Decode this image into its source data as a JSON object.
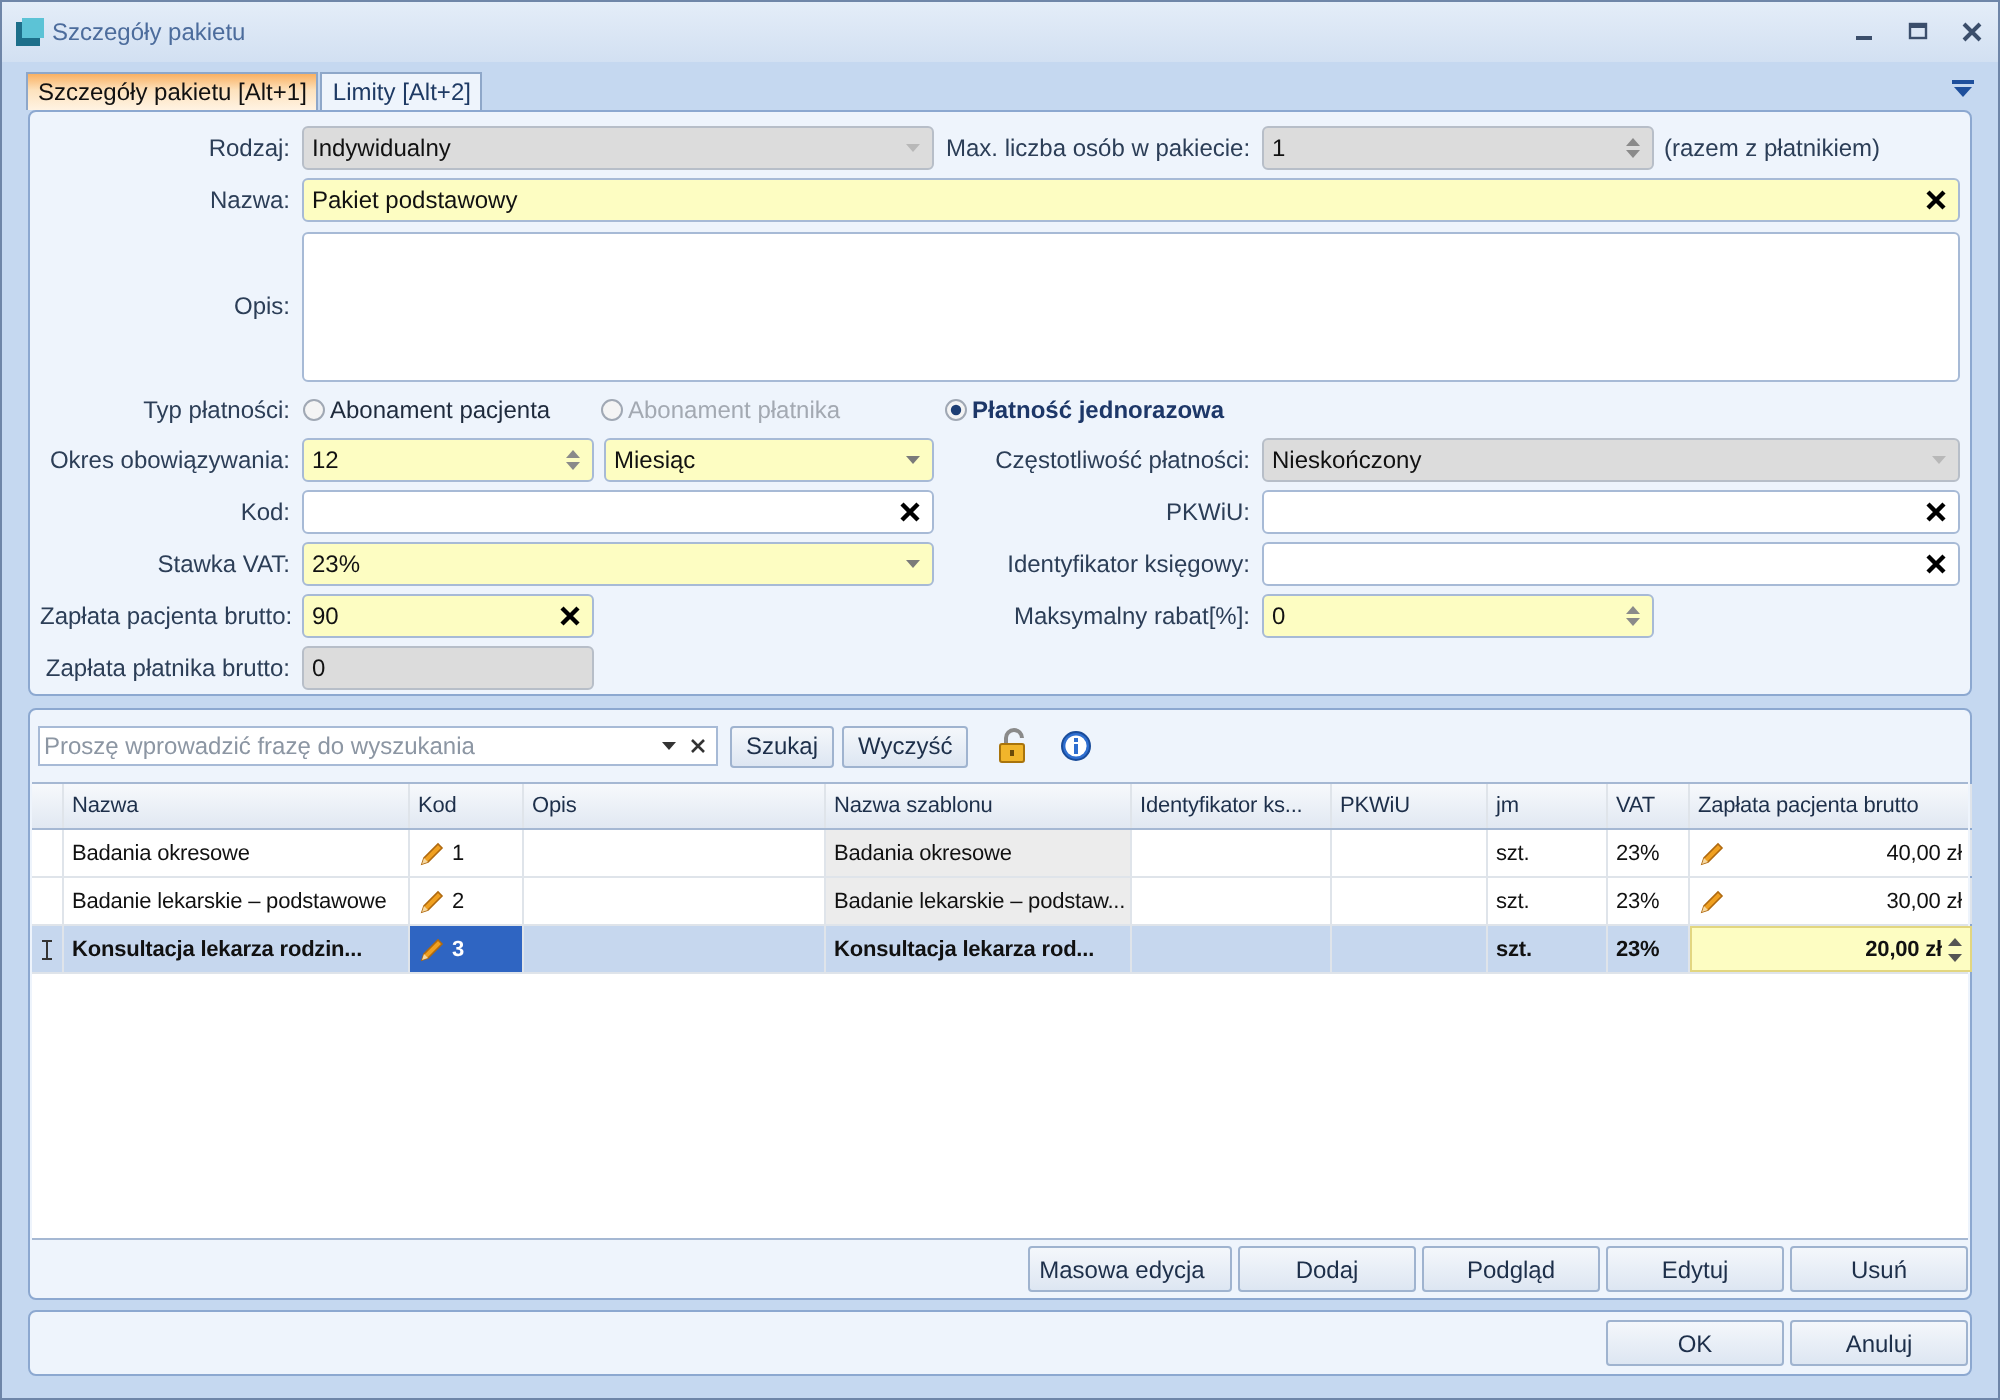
{
  "window": {
    "title": "Szczegóły pakietu"
  },
  "tabs": [
    {
      "label": "Szczegóły pakietu [Alt+1]",
      "selected": true
    },
    {
      "label": "Limity [Alt+2]",
      "selected": false
    }
  ],
  "form": {
    "fields": [
      {
        "label": "Rodzaj:",
        "kind": "combo",
        "value": "Indywidualny",
        "required": false,
        "disabled": true
      },
      {
        "label": "Max. liczba osób w pakiecie:",
        "kind": "spinner",
        "value": "1",
        "required": false,
        "disabled": true,
        "note": "(razem z płatnikiem)"
      },
      {
        "label": "Nazwa:",
        "kind": "text",
        "value": "Pakiet podstawowy",
        "required": true,
        "disabled": false
      },
      {
        "label": "Opis:",
        "kind": "memo",
        "required": false,
        "disabled": false
      },
      {
        "label": "Typ płatności:",
        "kind": "radio",
        "options": [
          {
            "label": "Abonament pacjenta",
            "selected": false,
            "disabled": false
          },
          {
            "label": "Abonament płatnika",
            "selected": false,
            "disabled": true
          },
          {
            "label": "Płatność jednorazowa",
            "selected": true,
            "disabled": false
          }
        ]
      },
      {
        "label": "Okres obowiązywania:",
        "kind": "spinner",
        "value": "12",
        "required": true,
        "disabled": false,
        "unit": {
          "kind": "combo",
          "value": "Miesiąc",
          "required": true,
          "disabled": false
        }
      },
      {
        "label": "Częstotliwość płatności:",
        "kind": "combo",
        "value": "Nieskończony",
        "required": false,
        "disabled": true
      },
      {
        "label": "Kod:",
        "kind": "text",
        "required": false,
        "disabled": false
      },
      {
        "label": "PKWiU:",
        "kind": "text",
        "required": false,
        "disabled": false
      },
      {
        "label": "Stawka VAT:",
        "kind": "combo",
        "value": "23%",
        "required": true,
        "disabled": false
      },
      {
        "label": "Identyfikator księgowy:",
        "kind": "text",
        "required": false,
        "disabled": false
      },
      {
        "label": "Zapłata pacjenta brutto:",
        "kind": "text",
        "value": "90",
        "required": true,
        "disabled": false
      },
      {
        "label": "Maksymalny rabat[%]:",
        "kind": "spinner",
        "value": "0",
        "required": true,
        "disabled": false
      },
      {
        "label": "Zapłata płatnika brutto:",
        "kind": "text",
        "value": "0",
        "required": false,
        "disabled": true
      }
    ]
  },
  "search": {
    "placeholder": "Proszę wprowadzić frazę do wyszukania"
  },
  "toolbar_buttons": [
    "Szukaj",
    "Wyczyść"
  ],
  "table": {
    "columns": [
      "Nazwa",
      "Kod",
      "Opis",
      "Nazwa szablonu",
      "Identyfikator ks...",
      "PKWiU",
      "jm",
      "VAT",
      "Zapłata pacjenta brutto"
    ],
    "rows": [
      {
        "nazwa": "Badania okresowe",
        "kod": "1",
        "szablon": "Badania okresowe",
        "jm": "szt.",
        "vat": "23%",
        "zaplata": "40,00 zł",
        "selected": false,
        "editing": false
      },
      {
        "nazwa": "Badanie lekarskie – podstawowe",
        "kod": "2",
        "szablon": "Badanie lekarskie – podstaw...",
        "jm": "szt.",
        "vat": "23%",
        "zaplata": "30,00 zł",
        "selected": false,
        "editing": false
      },
      {
        "nazwa": "Konsultacja lekarza rodzin...",
        "kod": "3",
        "szablon": "Konsultacja lekarza rod...",
        "jm": "szt.",
        "vat": "23%",
        "zaplata": "20,00 zł",
        "selected": true,
        "editing": true
      }
    ]
  },
  "grid_buttons": [
    {
      "label": "Masowa edycja",
      "kind": "menu"
    },
    {
      "label": "Dodaj",
      "kind": "plain"
    },
    {
      "label": "Podgląd",
      "kind": "plain"
    },
    {
      "label": "Edytuj",
      "kind": "plain"
    },
    {
      "label": "Usuń",
      "kind": "plain"
    }
  ],
  "dialog_buttons": [
    "OK",
    "Anuluj"
  ]
}
